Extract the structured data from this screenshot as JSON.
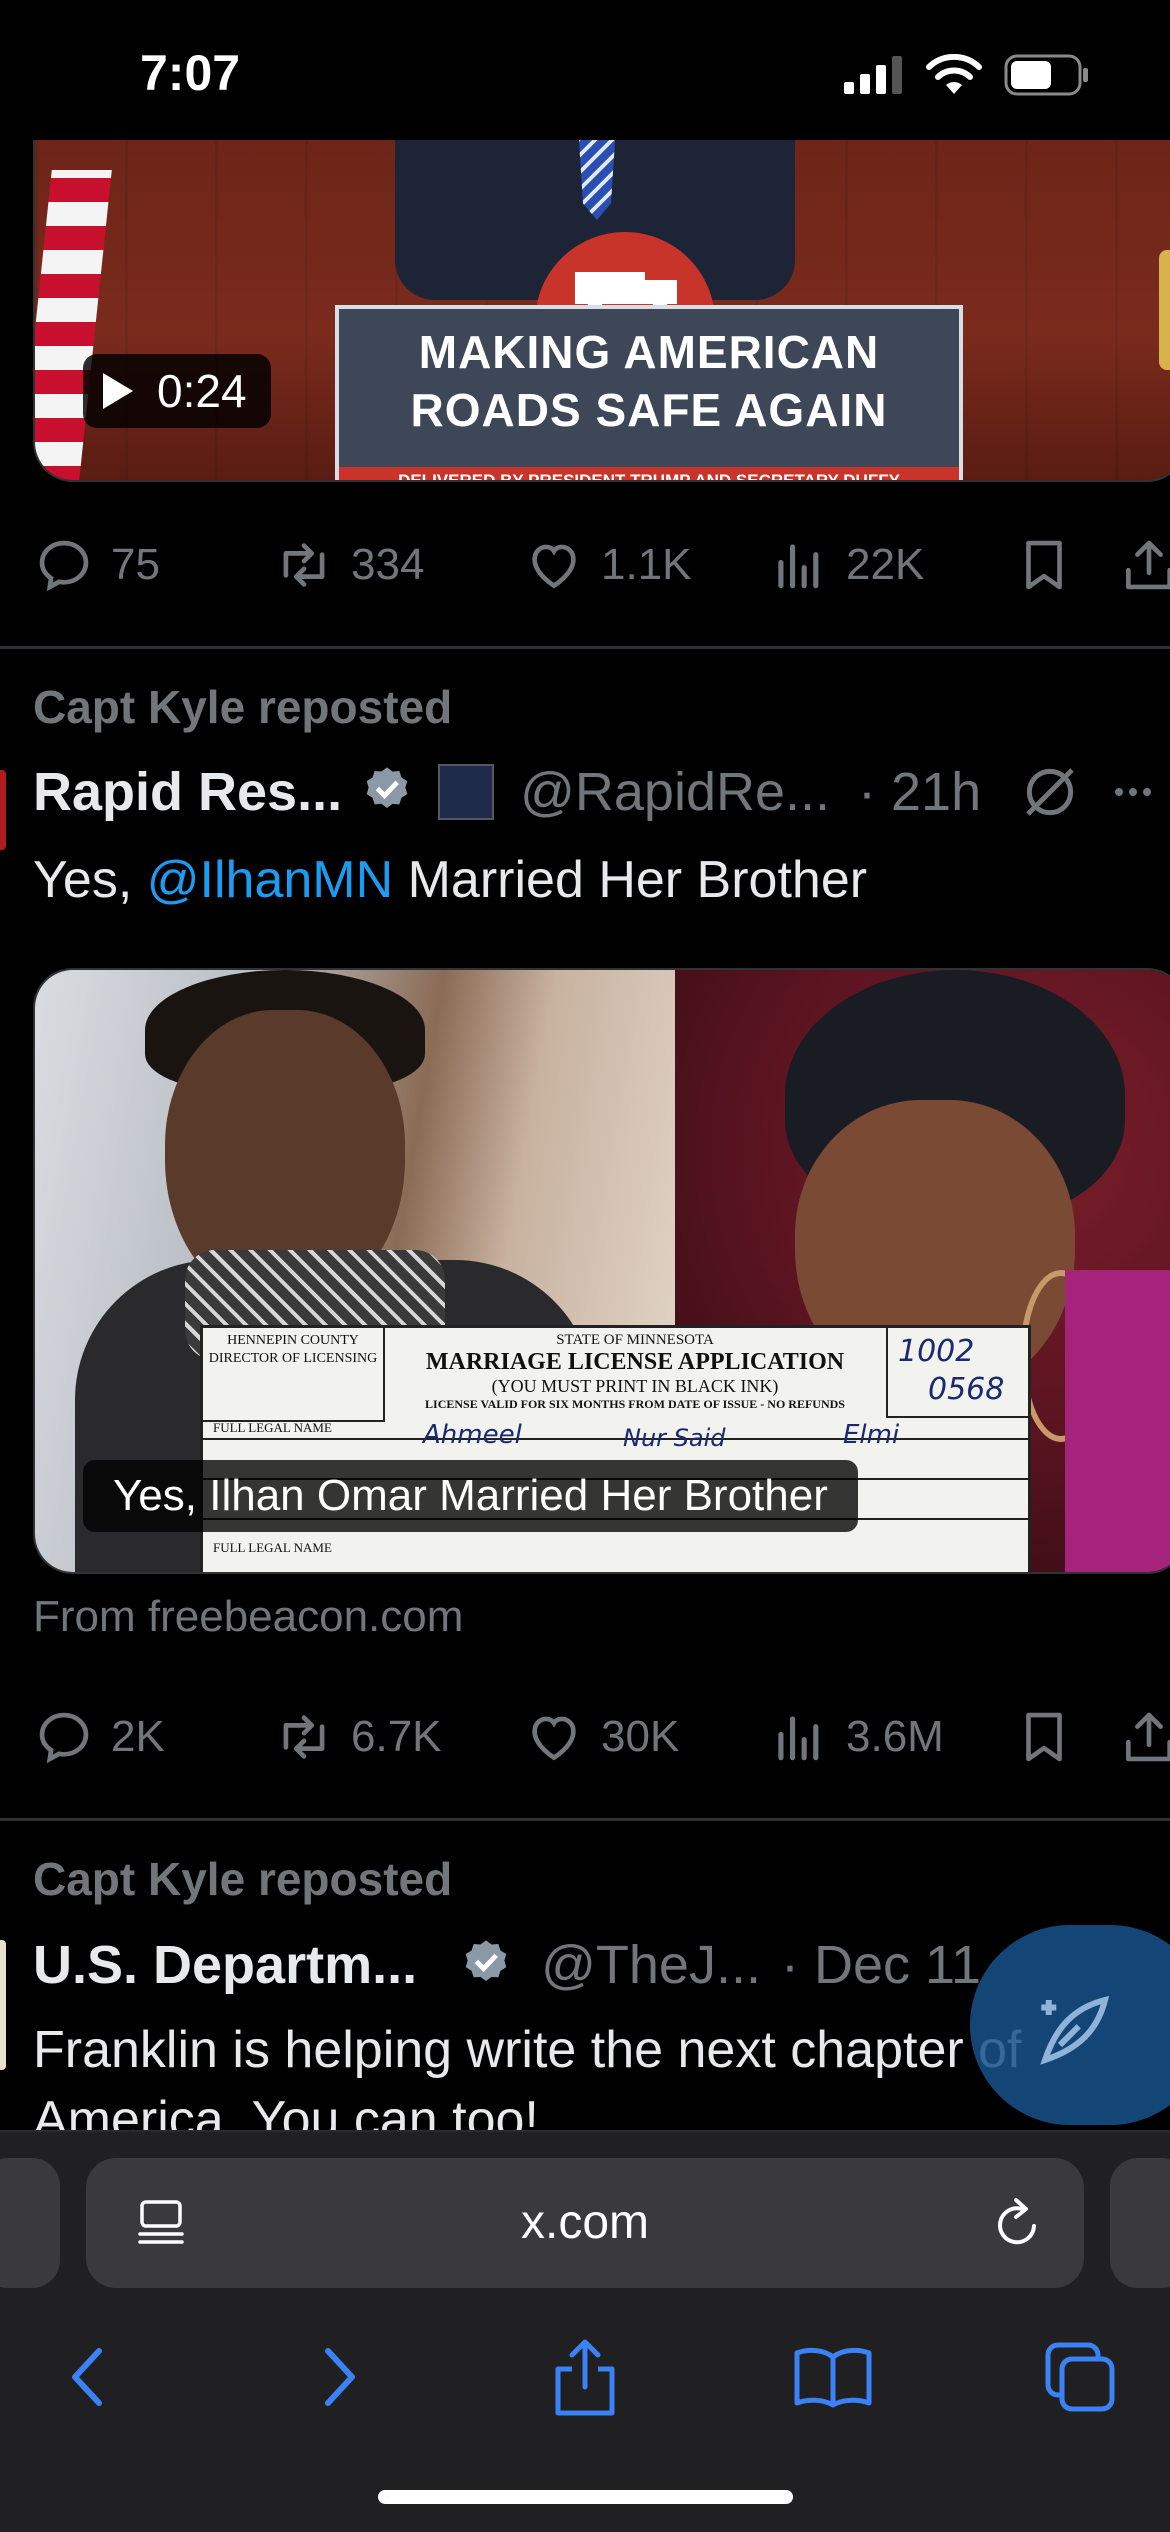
{
  "status_bar": {
    "time": "7:07"
  },
  "tweet1": {
    "video": {
      "lectern_line1": "MAKING AMERICAN",
      "lectern_line2": "ROADS SAFE AGAIN",
      "lectern_subtitle": "DELIVERED BY PRESIDENT TRUMP AND SECRETARY DUFFY",
      "duration": "0:24"
    },
    "actions": {
      "replies": "75",
      "reposts": "334",
      "likes": "1.1K",
      "views": "22K"
    }
  },
  "tweet2": {
    "repost_line": "Capt Kyle reposted",
    "name": "Rapid Res...",
    "handle": "@RapidRe...",
    "time": "· 21h",
    "text_prefix": "Yes, ",
    "mention": "@IlhanMN",
    "text_suffix": " Married Her Brother",
    "media": {
      "caption": "Yes, Ilhan Omar Married Her Brother",
      "doc_county": "HENNEPIN COUNTY",
      "doc_director": "DIRECTOR OF LICENSING",
      "doc_state": "STATE OF MINNESOTA",
      "doc_title": "MARRIAGE LICENSE APPLICATION",
      "doc_sub": "(YOU MUST PRINT IN BLACK INK)",
      "doc_valid": "LICENSE VALID FOR SIX MONTHS FROM DATE OF ISSUE - NO REFUNDS",
      "doc_full_name": "FULL LEGAL NAME",
      "doc_first": "Ahmeel",
      "doc_middle": "Nur Said",
      "doc_last": "Elmi",
      "doc_cart_no": "1002",
      "doc_image_no": "0568"
    },
    "source": "From freebeacon.com",
    "actions": {
      "replies": "2K",
      "reposts": "6.7K",
      "likes": "30K",
      "views": "3.6M"
    }
  },
  "tweet3": {
    "repost_line": "Capt Kyle reposted",
    "name": "U.S. Departm...",
    "handle": "@TheJ...",
    "time": "· Dec 11",
    "text_line1": "Franklin is helping write the next chapter of",
    "text_line2": "America. You can too!"
  },
  "browser": {
    "url": "x.com"
  },
  "colors": {
    "background": "#000000",
    "text": "#e7e9ea",
    "muted": "#71767b",
    "accent": "#1d9bf0",
    "toolbar_icon": "#3b82f6"
  },
  "icons": {
    "reply": "reply-icon",
    "repost": "repost-icon",
    "like": "heart-icon",
    "views": "views-icon",
    "bookmark": "bookmark-icon",
    "share": "share-icon",
    "verified": "verified-badge-icon",
    "grok": "grok-icon",
    "more": "more-icon"
  }
}
